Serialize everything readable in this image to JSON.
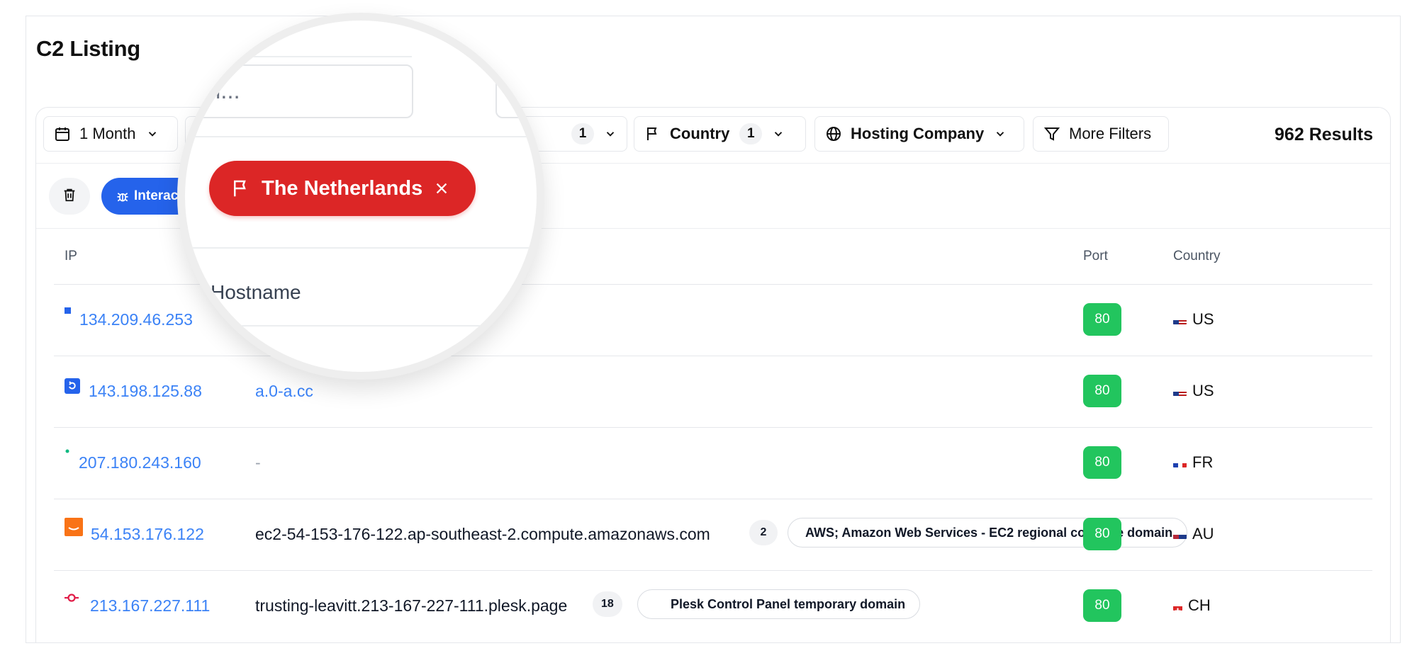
{
  "page": {
    "title": "C2 Listing"
  },
  "filters": {
    "time_range": "1 Month",
    "partial_count": "1",
    "country_label": "Country",
    "country_count": "1",
    "hosting_label": "Hosting Company",
    "more_filters": "More Filters",
    "results": "962 Results"
  },
  "active_chips": {
    "interaction_chip": "Interac",
    "country_chip": "The Netherlands"
  },
  "table": {
    "headers": {
      "ip": "IP",
      "port": "Port",
      "country": "Country"
    },
    "rows": [
      {
        "ip": "134.209.46.253",
        "hostname": "",
        "hostname_count": "",
        "tag": "",
        "port": "80",
        "country": "US",
        "favicon": "blue-square-icon"
      },
      {
        "ip": "143.198.125.88",
        "hostname": "a.0-a.cc",
        "hostname_count": "",
        "tag": "",
        "port": "80",
        "country": "US",
        "favicon": "blue-refresh-icon"
      },
      {
        "ip": "207.180.243.160",
        "hostname": "-",
        "hostname_count": "",
        "tag": "",
        "port": "80",
        "country": "FR",
        "favicon": "green-dot-icon"
      },
      {
        "ip": "54.153.176.122",
        "hostname": "ec2-54-153-176-122.ap-southeast-2.compute.amazonaws.com",
        "hostname_count": "2",
        "tag": "AWS; Amazon Web Services -  EC2 regional compute domain",
        "port": "80",
        "country": "AU",
        "favicon": "aws-icon"
      },
      {
        "ip": "213.167.227.111",
        "hostname": "trusting-leavitt.213-167-227-111.plesk.page",
        "hostname_count": "18",
        "tag": "Plesk Control Panel temporary domain",
        "port": "80",
        "country": "CH",
        "favicon": "plesk-icon"
      }
    ]
  },
  "magnifier": {
    "search_placeholder": "arch...",
    "chip_label": "The Netherlands",
    "hostname_header": "Hostname"
  },
  "colors": {
    "link_blue": "#3b82f6",
    "chip_blue": "#2563eb",
    "chip_red": "#dc2626",
    "port_green": "#22c55e"
  }
}
